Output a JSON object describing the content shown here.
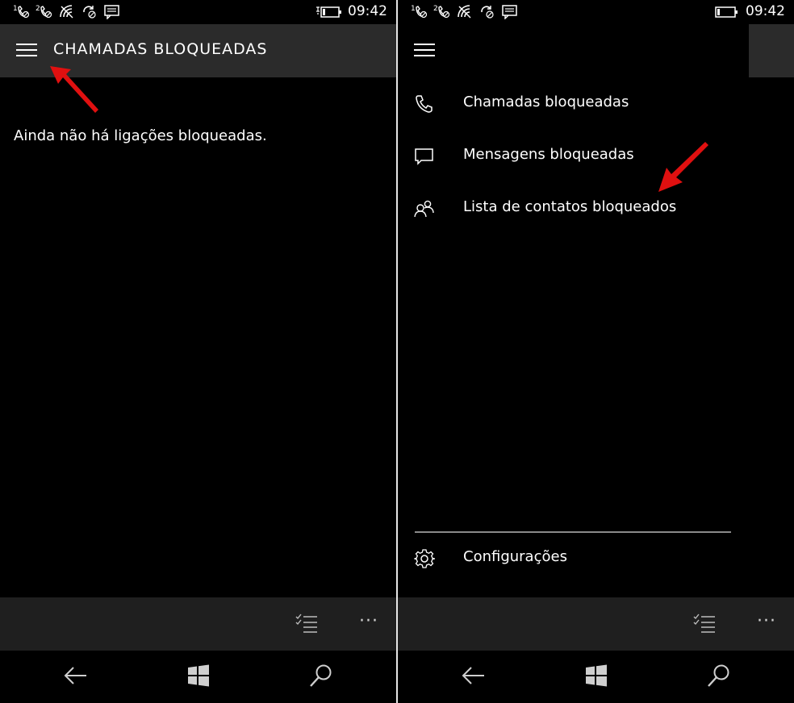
{
  "status_bar": {
    "time": "09:42",
    "sim1_marker": "1",
    "sim2_marker": "2",
    "icons": [
      "sim1-call-icon",
      "sim2-call-icon",
      "wifi-icon",
      "data-sync-icon",
      "message-icon",
      "battery-icon"
    ]
  },
  "left_screen": {
    "title": "CHAMADAS BLOQUEADAS",
    "empty_message": "Ainda não há ligações bloqueadas.",
    "commands": {
      "select_icon": "multi-select-icon",
      "more_label": "···"
    }
  },
  "right_screen": {
    "menu_items": [
      {
        "label": "Chamadas bloqueadas",
        "icon": "phone-icon"
      },
      {
        "label": "Mensagens bloqueadas",
        "icon": "message-icon"
      },
      {
        "label": "Lista de contatos bloqueados",
        "icon": "contacts-icon"
      }
    ],
    "settings": {
      "label": "Configurações",
      "icon": "gear-icon"
    },
    "commands": {
      "select_icon": "multi-select-icon",
      "more_label": "···"
    }
  },
  "nav": {
    "icons": [
      "back-arrow-icon",
      "windows-logo-icon",
      "search-icon"
    ]
  },
  "colors": {
    "background": "#000000",
    "app_bar": "#2b2b2b",
    "command_bar": "#1f1f1f",
    "text": "#ffffff",
    "annotation_arrow": "#e01010",
    "separator": "#8a8a8a"
  }
}
